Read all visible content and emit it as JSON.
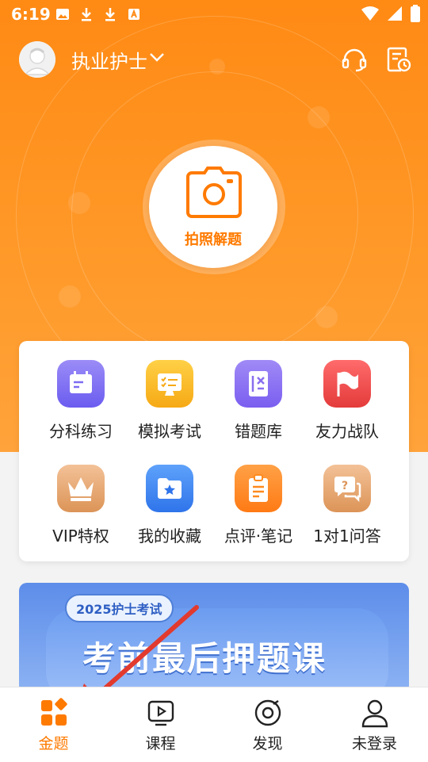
{
  "status_bar": {
    "time": "6:19"
  },
  "header": {
    "exam": "执业护士"
  },
  "camera": {
    "label": "拍照解题"
  },
  "features": [
    {
      "label": "分科练习",
      "color": "#7b6df2"
    },
    {
      "label": "模拟考试",
      "color": "#f7b81a"
    },
    {
      "label": "错题库",
      "color": "#8a6ef0"
    },
    {
      "label": "友力战队",
      "color": "#ef4a4a"
    },
    {
      "label": "VIP特权",
      "color": "#e8a772"
    },
    {
      "label": "我的收藏",
      "color": "#3d86f2"
    },
    {
      "label": "点评·笔记",
      "color": "#ff8a1e"
    },
    {
      "label": "1对1问答",
      "color": "#e8a772"
    }
  ],
  "banner": {
    "tag": "2025护士考试",
    "title": "考前最后押题课"
  },
  "nav": [
    {
      "label": "金题"
    },
    {
      "label": "课程"
    },
    {
      "label": "发现"
    },
    {
      "label": "未登录"
    }
  ],
  "colors": {
    "accent": "#ff8a14",
    "active_nav": "#ff7a00"
  }
}
